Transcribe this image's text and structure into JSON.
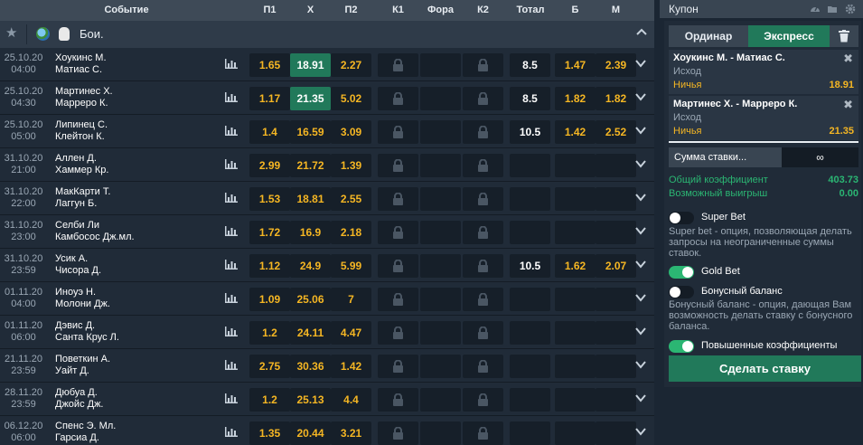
{
  "header": {
    "event": "Событие",
    "p1": "П1",
    "x": "Х",
    "p2": "П2",
    "k1": "К1",
    "fora": "Фора",
    "k2": "К2",
    "total": "Тотал",
    "b": "Б",
    "m": "М"
  },
  "sport": {
    "title": "Бои."
  },
  "rows": [
    {
      "date": "25.10.20",
      "time": "04:00",
      "team1": "Хоукинс М.",
      "team2": "Матиас С.",
      "p1": "1.65",
      "x": "18.91",
      "p2": "2.27",
      "total": "8.5",
      "b": "1.47",
      "m": "2.39",
      "selected": "x"
    },
    {
      "date": "25.10.20",
      "time": "04:30",
      "team1": "Мартинес Х.",
      "team2": "Марреро К.",
      "p1": "1.17",
      "x": "21.35",
      "p2": "5.02",
      "total": "8.5",
      "b": "1.82",
      "m": "1.82",
      "selected": "x"
    },
    {
      "date": "25.10.20",
      "time": "05:00",
      "team1": "Липинец С.",
      "team2": "Клейтон К.",
      "p1": "1.4",
      "x": "16.59",
      "p2": "3.09",
      "total": "10.5",
      "b": "1.42",
      "m": "2.52",
      "selected": ""
    },
    {
      "date": "31.10.20",
      "time": "21:00",
      "team1": "Аллен Д.",
      "team2": "Хаммер Кр.",
      "p1": "2.99",
      "x": "21.72",
      "p2": "1.39",
      "total": "",
      "b": "",
      "m": "",
      "selected": ""
    },
    {
      "date": "31.10.20",
      "time": "22:00",
      "team1": "МакКарти Т.",
      "team2": "Лаггун Б.",
      "p1": "1.53",
      "x": "18.81",
      "p2": "2.55",
      "total": "",
      "b": "",
      "m": "",
      "selected": ""
    },
    {
      "date": "31.10.20",
      "time": "23:00",
      "team1": "Селби Ли",
      "team2": "Камбосос Дж.мл.",
      "p1": "1.72",
      "x": "16.9",
      "p2": "2.18",
      "total": "",
      "b": "",
      "m": "",
      "selected": ""
    },
    {
      "date": "31.10.20",
      "time": "23:59",
      "team1": "Усик А.",
      "team2": "Чисора Д.",
      "p1": "1.12",
      "x": "24.9",
      "p2": "5.99",
      "total": "10.5",
      "b": "1.62",
      "m": "2.07",
      "selected": ""
    },
    {
      "date": "01.11.20",
      "time": "04:00",
      "team1": "Иноуэ Н.",
      "team2": "Молони Дж.",
      "p1": "1.09",
      "x": "25.06",
      "p2": "7",
      "total": "",
      "b": "",
      "m": "",
      "selected": ""
    },
    {
      "date": "01.11.20",
      "time": "06:00",
      "team1": "Дэвис Д.",
      "team2": "Санта Крус Л.",
      "p1": "1.2",
      "x": "24.11",
      "p2": "4.47",
      "total": "",
      "b": "",
      "m": "",
      "selected": ""
    },
    {
      "date": "21.11.20",
      "time": "23:59",
      "team1": "Поветкин А.",
      "team2": "Уайт Д.",
      "p1": "2.75",
      "x": "30.36",
      "p2": "1.42",
      "total": "",
      "b": "",
      "m": "",
      "selected": ""
    },
    {
      "date": "28.11.20",
      "time": "23:59",
      "team1": "Дюбуа Д.",
      "team2": "Джойс Дж.",
      "p1": "1.2",
      "x": "25.13",
      "p2": "4.4",
      "total": "",
      "b": "",
      "m": "",
      "selected": ""
    },
    {
      "date": "06.12.20",
      "time": "06:00",
      "team1": "Спенс Э. Мл.",
      "team2": "Гарсиа Д.",
      "p1": "1.35",
      "x": "20.44",
      "p2": "3.21",
      "total": "",
      "b": "",
      "m": "",
      "selected": ""
    }
  ],
  "coupon": {
    "title": "Купон",
    "tab_ordinar": "Ординар",
    "tab_express": "Экспресс",
    "bets": [
      {
        "match": "Хоукинс М. - Матиас С.",
        "outcome_label": "Исход",
        "outcome": "Ничья",
        "odd": "18.91"
      },
      {
        "match": "Мартинес Х. - Марреро К.",
        "outcome_label": "Исход",
        "outcome": "Ничья",
        "odd": "21.35"
      }
    ],
    "stake_label": "Сумма ставки...",
    "stake_value": "∞",
    "total_coef_label": "Общий коэффициент",
    "total_coef": "403.73",
    "possible_win_label": "Возможный выигрыш",
    "possible_win": "0.00",
    "superbet_label": "Super Bet",
    "superbet_desc": "Super bet - опция, позволяющая делать запросы на неограниченные суммы ставок.",
    "goldbet_label": "Gold Bet",
    "bonus_label": "Бонусный баланс",
    "bonus_desc": "Бонусный баланс - опция, дающая Вам возможность делать ставку с бонусного баланса.",
    "raised_label": "Повышенные коэффициенты",
    "make_bet": "Сделать ставку"
  },
  "colors": {
    "accent": "#21795a",
    "odds": "#f5b623",
    "positive": "#2bb673"
  }
}
